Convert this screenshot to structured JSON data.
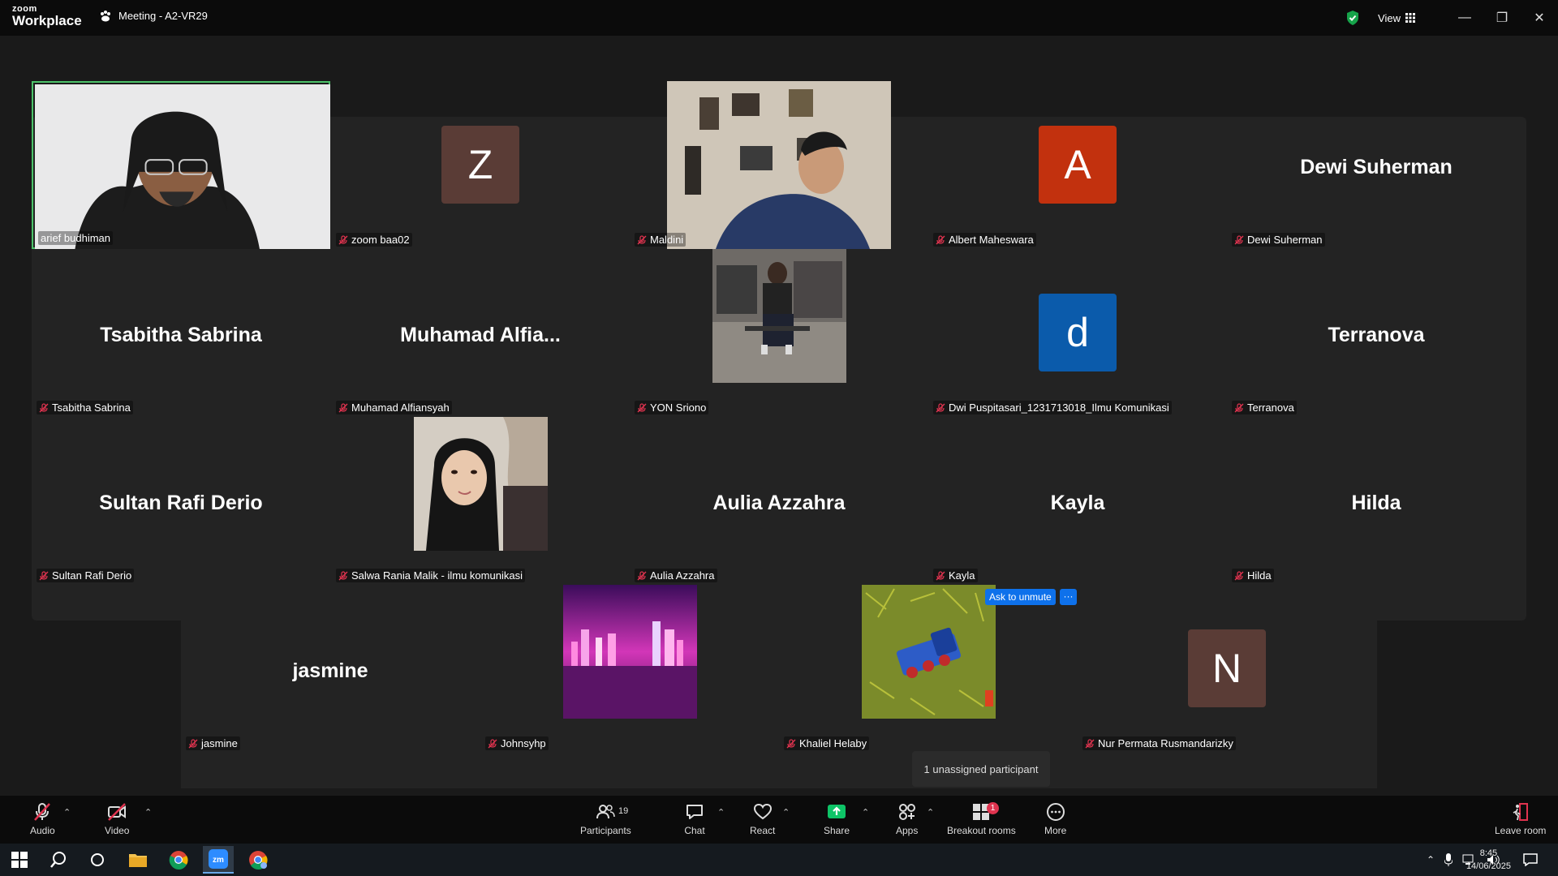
{
  "titlebar": {
    "logo_line1": "zoom",
    "logo_line2": "Workplace",
    "meeting_title": "Meeting - A2-VR29",
    "view_label": "View",
    "minimize": "—",
    "restore": "❐",
    "close": "✕"
  },
  "tiles": [
    {
      "label": "arief budhiman",
      "type": "video",
      "muted": false,
      "active": true
    },
    {
      "label": "zoom baa02",
      "type": "avatar",
      "initial": "Z",
      "color": "#5a3c36",
      "muted": true
    },
    {
      "label": "Maldini",
      "type": "video",
      "muted": true
    },
    {
      "label": "Albert Maheswara",
      "type": "avatar",
      "initial": "A",
      "color": "#c2310e",
      "muted": true
    },
    {
      "label": "Dewi Suherman",
      "type": "name",
      "display": "Dewi Suherman",
      "muted": true
    },
    {
      "label": "Tsabitha Sabrina",
      "type": "name",
      "display": "Tsabitha Sabrina",
      "muted": true
    },
    {
      "label": "Muhamad Alfiansyah",
      "type": "name",
      "display": "Muhamad  Alfia...",
      "muted": true
    },
    {
      "label": "YON Sriono",
      "type": "picture",
      "muted": true
    },
    {
      "label": "Dwi Puspitasari_1231713018_Ilmu Komunikasi",
      "type": "avatar",
      "initial": "d",
      "color": "#0b5bab",
      "muted": true
    },
    {
      "label": "Terranova",
      "type": "name",
      "display": "Terranova",
      "muted": true
    },
    {
      "label": "Sultan Rafi Derio",
      "type": "name",
      "display": "Sultan Rafi Derio",
      "muted": true
    },
    {
      "label": "Salwa Rania Malik - ilmu komunikasi",
      "type": "picture",
      "muted": true
    },
    {
      "label": "Aulia Azzahra",
      "type": "name",
      "display": "Aulia Azzahra",
      "muted": true
    },
    {
      "label": "Kayla",
      "type": "name",
      "display": "Kayla",
      "muted": true
    },
    {
      "label": "Hilda",
      "type": "name",
      "display": "Hilda",
      "muted": true
    },
    {
      "label": "jasmine",
      "type": "name",
      "display": "jasmine",
      "muted": true
    },
    {
      "label": "Johnsyhp",
      "type": "picture",
      "muted": true
    },
    {
      "label": "Khaliel Helaby",
      "type": "picture",
      "muted": true
    },
    {
      "label": "Nur Permata Rusmandarizky",
      "type": "avatar",
      "initial": "N",
      "color": "#5a3c36",
      "muted": true
    }
  ],
  "unmute": {
    "label": "Ask to unmute",
    "more": "···"
  },
  "tooltip": "1 unassigned participant",
  "toolbar": {
    "audio": "Audio",
    "video": "Video",
    "participants": "Participants",
    "participants_count": "19",
    "chat": "Chat",
    "react": "React",
    "share": "Share",
    "apps": "Apps",
    "breakout": "Breakout rooms",
    "breakout_badge": "1",
    "more": "More",
    "leave": "Leave room"
  },
  "taskbar": {
    "time": "8:45",
    "date": "14/06/2025"
  },
  "colors": {
    "active_border": "#4dc26a",
    "share_green": "#0ec467",
    "unmute_blue": "#0e71eb",
    "mute_red": "#e0334f"
  }
}
